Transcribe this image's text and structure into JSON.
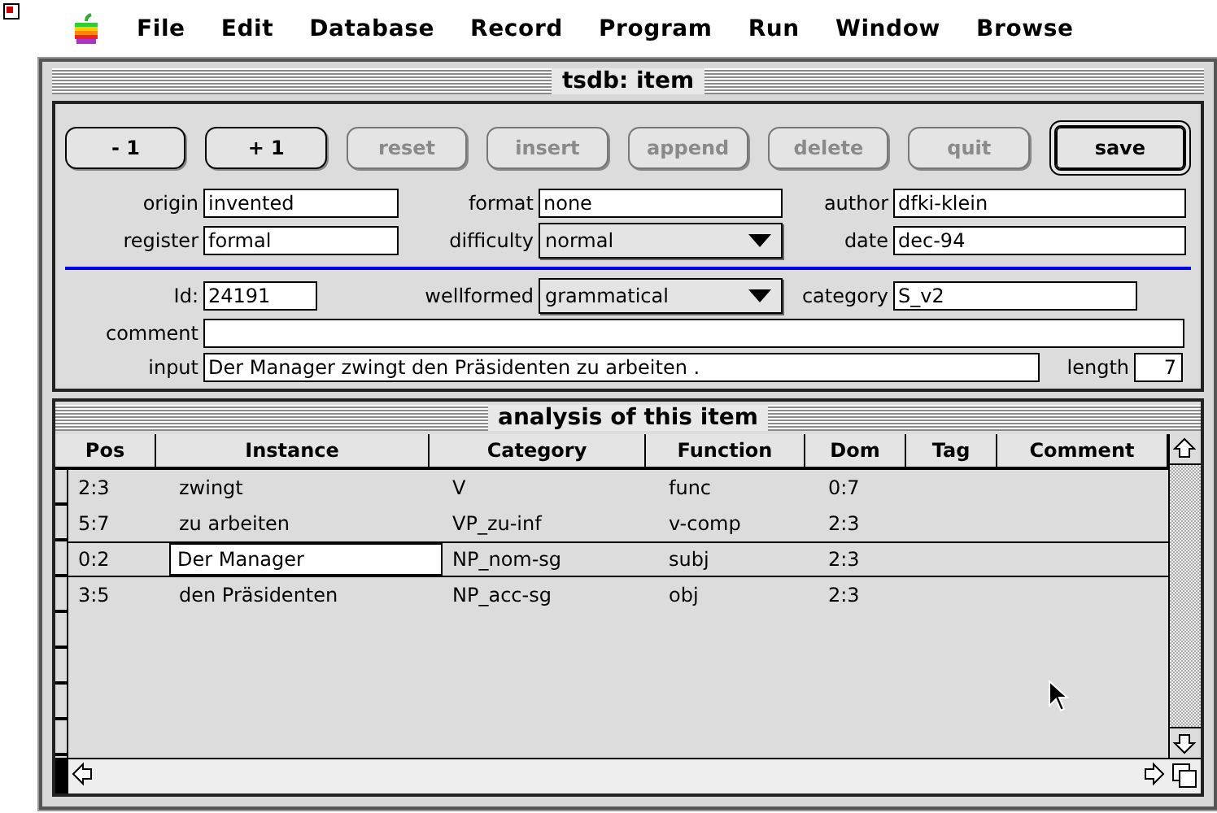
{
  "menu_bar": {
    "items": [
      "File",
      "Edit",
      "Database",
      "Record",
      "Program",
      "Run",
      "Window",
      "Browse"
    ]
  },
  "window": {
    "title": "tsdb: item"
  },
  "buttons": [
    {
      "label": "- 1",
      "disabled": false,
      "default": false
    },
    {
      "label": "+ 1",
      "disabled": false,
      "default": false
    },
    {
      "label": "reset",
      "disabled": true,
      "default": false
    },
    {
      "label": "insert",
      "disabled": true,
      "default": false
    },
    {
      "label": "append",
      "disabled": true,
      "default": false
    },
    {
      "label": "delete",
      "disabled": true,
      "default": false
    },
    {
      "label": "quit",
      "disabled": true,
      "default": false
    },
    {
      "label": "save",
      "disabled": false,
      "default": true
    }
  ],
  "header_fields": [
    {
      "label": "origin",
      "value": "invented",
      "kind": "text"
    },
    {
      "label": "format",
      "value": "none",
      "kind": "text"
    },
    {
      "label": "author",
      "value": "dfki-klein",
      "kind": "text"
    },
    {
      "label": "register",
      "value": "formal",
      "kind": "text"
    },
    {
      "label": "difficulty",
      "value": "normal",
      "kind": "popup"
    },
    {
      "label": "date",
      "value": "dec-94",
      "kind": "text"
    }
  ],
  "item_fields": [
    {
      "label": "Id:",
      "value": "24191",
      "kind": "text"
    },
    {
      "label": "wellformed",
      "value": "grammatical",
      "kind": "popup"
    },
    {
      "label": "category",
      "value": "S_v2",
      "kind": "text"
    }
  ],
  "comment": {
    "label": "comment"
  },
  "input": {
    "label": "input",
    "value": "Der Manager zwingt den Präsidenten zu arbeiten .",
    "length_label": "length",
    "length": "7"
  },
  "analysis": {
    "title": "analysis of this item",
    "columns": [
      "Pos",
      "Instance",
      "Category",
      "Function",
      "Dom",
      "Tag",
      "Comment"
    ],
    "rows": [
      {
        "cells": [
          "2:3",
          "zwingt",
          "V",
          "func",
          "0:7",
          "",
          ""
        ],
        "selected": false
      },
      {
        "cells": [
          "5:7",
          "zu arbeiten",
          "VP_zu-inf",
          "v-comp",
          "2:3",
          "",
          ""
        ],
        "selected": false
      },
      {
        "cells": [
          "0:2",
          "Der Manager",
          "NP_nom-sg",
          "subj",
          "2:3",
          "",
          ""
        ],
        "selected": true
      },
      {
        "cells": [
          "3:5",
          "den Präsidenten",
          "NP_acc-sg",
          "obj",
          "2:3",
          "",
          ""
        ],
        "selected": false
      }
    ]
  }
}
